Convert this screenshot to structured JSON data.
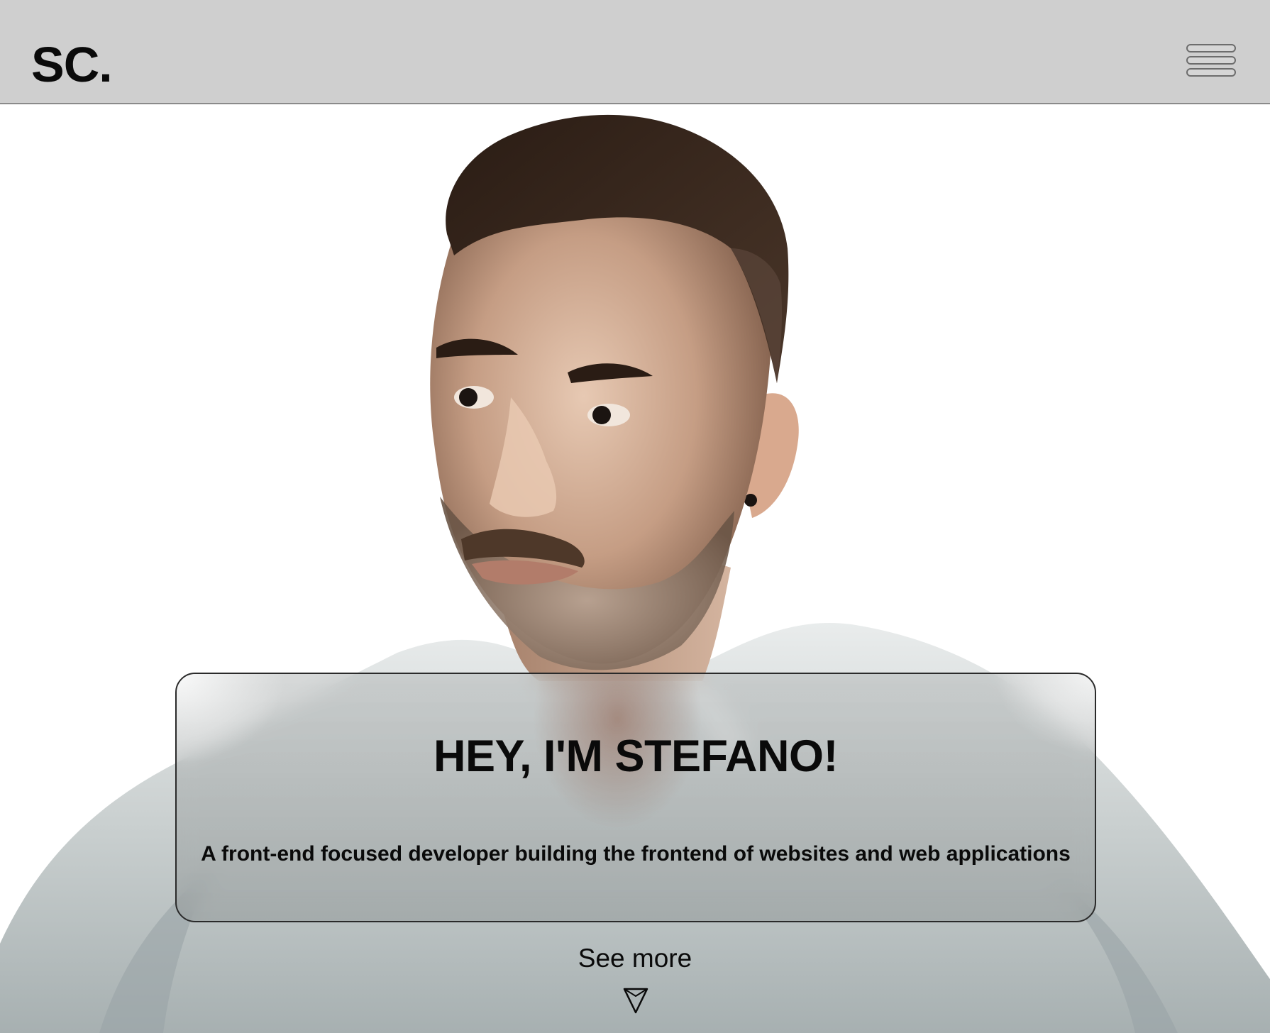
{
  "header": {
    "logo_text": "SC.",
    "menu_icon": "hamburger-menu-icon"
  },
  "hero": {
    "portrait_description_icon": "portrait-illustration",
    "title": "HEY, I'M STEFANO!",
    "subtitle": "A front-end focused developer building the frontend of websites and web applications",
    "see_more_label": "See more",
    "see_more_icon": "down-arrow-icon"
  },
  "colors": {
    "header_bg": "#cfcfcf",
    "page_bg": "#ffffff",
    "text": "#0a0a0a",
    "card_border": "#2a2a2a"
  }
}
